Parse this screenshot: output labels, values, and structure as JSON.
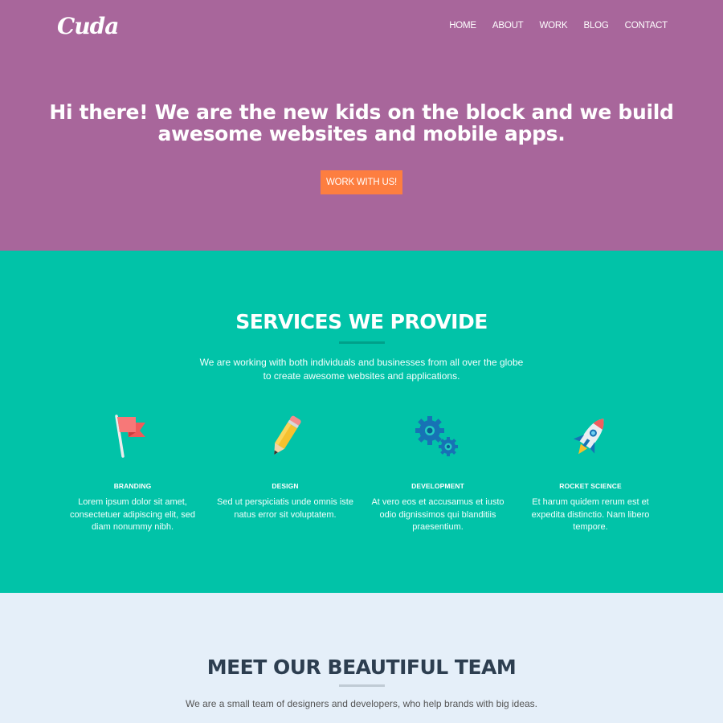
{
  "header": {
    "logo": "Cuda",
    "nav": [
      "HOME",
      "ABOUT",
      "WORK",
      "BLOG",
      "CONTACT"
    ]
  },
  "hero": {
    "title_line1": "Hi there! We are the new kids on the block and we build",
    "title_line2": "awesome websites and mobile apps.",
    "cta_label": "WORK WITH US!"
  },
  "services": {
    "title": "SERVICES WE PROVIDE",
    "desc_line1": "We are working with both individuals and businesses from all over the globe",
    "desc_line2": "to create awesome websites and applications.",
    "items": [
      {
        "icon": "flag-icon",
        "title": "BRANDING",
        "text": "Lorem ipsum dolor sit amet, consectetuer adipiscing elit, sed diam nonummy nibh."
      },
      {
        "icon": "pencil-icon",
        "title": "DESIGN",
        "text": "Sed ut perspiciatis unde omnis iste natus error sit voluptatem."
      },
      {
        "icon": "gears-icon",
        "title": "DEVELOPMENT",
        "text": "At vero eos et accusamus et iusto odio dignissimos qui blanditiis praesentium."
      },
      {
        "icon": "rocket-icon",
        "title": "ROCKET SCIENCE",
        "text": "Et harum quidem rerum est et expedita distinctio. Nam libero tempore."
      }
    ]
  },
  "team": {
    "title": "MEET OUR BEAUTIFUL TEAM",
    "desc": "We are a small team of designers and developers, who help brands with big ideas."
  },
  "colors": {
    "hero_bg": "#a8669b",
    "accent_button": "#fd7e40",
    "services_bg": "#01c3a8",
    "team_bg": "#e5eff9",
    "team_text": "#2d3e50"
  }
}
